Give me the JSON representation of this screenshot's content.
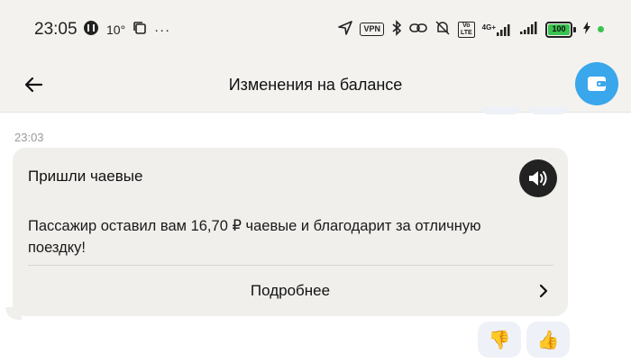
{
  "status_bar": {
    "time": "23:05",
    "temperature": "10°",
    "more": "···",
    "vpn": "VPN",
    "volte_top": "Vo",
    "volte_bottom": "LTE",
    "network": "4G+",
    "battery_level": "100"
  },
  "header": {
    "title": "Изменения на балансе"
  },
  "message": {
    "time": "23:03",
    "title": "Пришли чаевые",
    "body": "Пассажир оставил вам 16,70 ₽ чаевые и благодарит за отличную поездку!",
    "details_label": "Подробнее"
  },
  "reactions": {
    "dislike": "👎",
    "like": "👍"
  },
  "colors": {
    "accent_blue": "#3aa6ec",
    "bubble_bg": "#f0efec",
    "header_bg": "#f3f2ef",
    "reaction_bg": "#eef1f7",
    "battery_green": "#39c24f"
  },
  "icons": [
    "back-arrow-icon",
    "wallet-icon",
    "speaker-icon",
    "chevron-right-icon",
    "location-icon",
    "bluetooth-icon",
    "link-icon",
    "mute-icon",
    "signal-icon"
  ]
}
